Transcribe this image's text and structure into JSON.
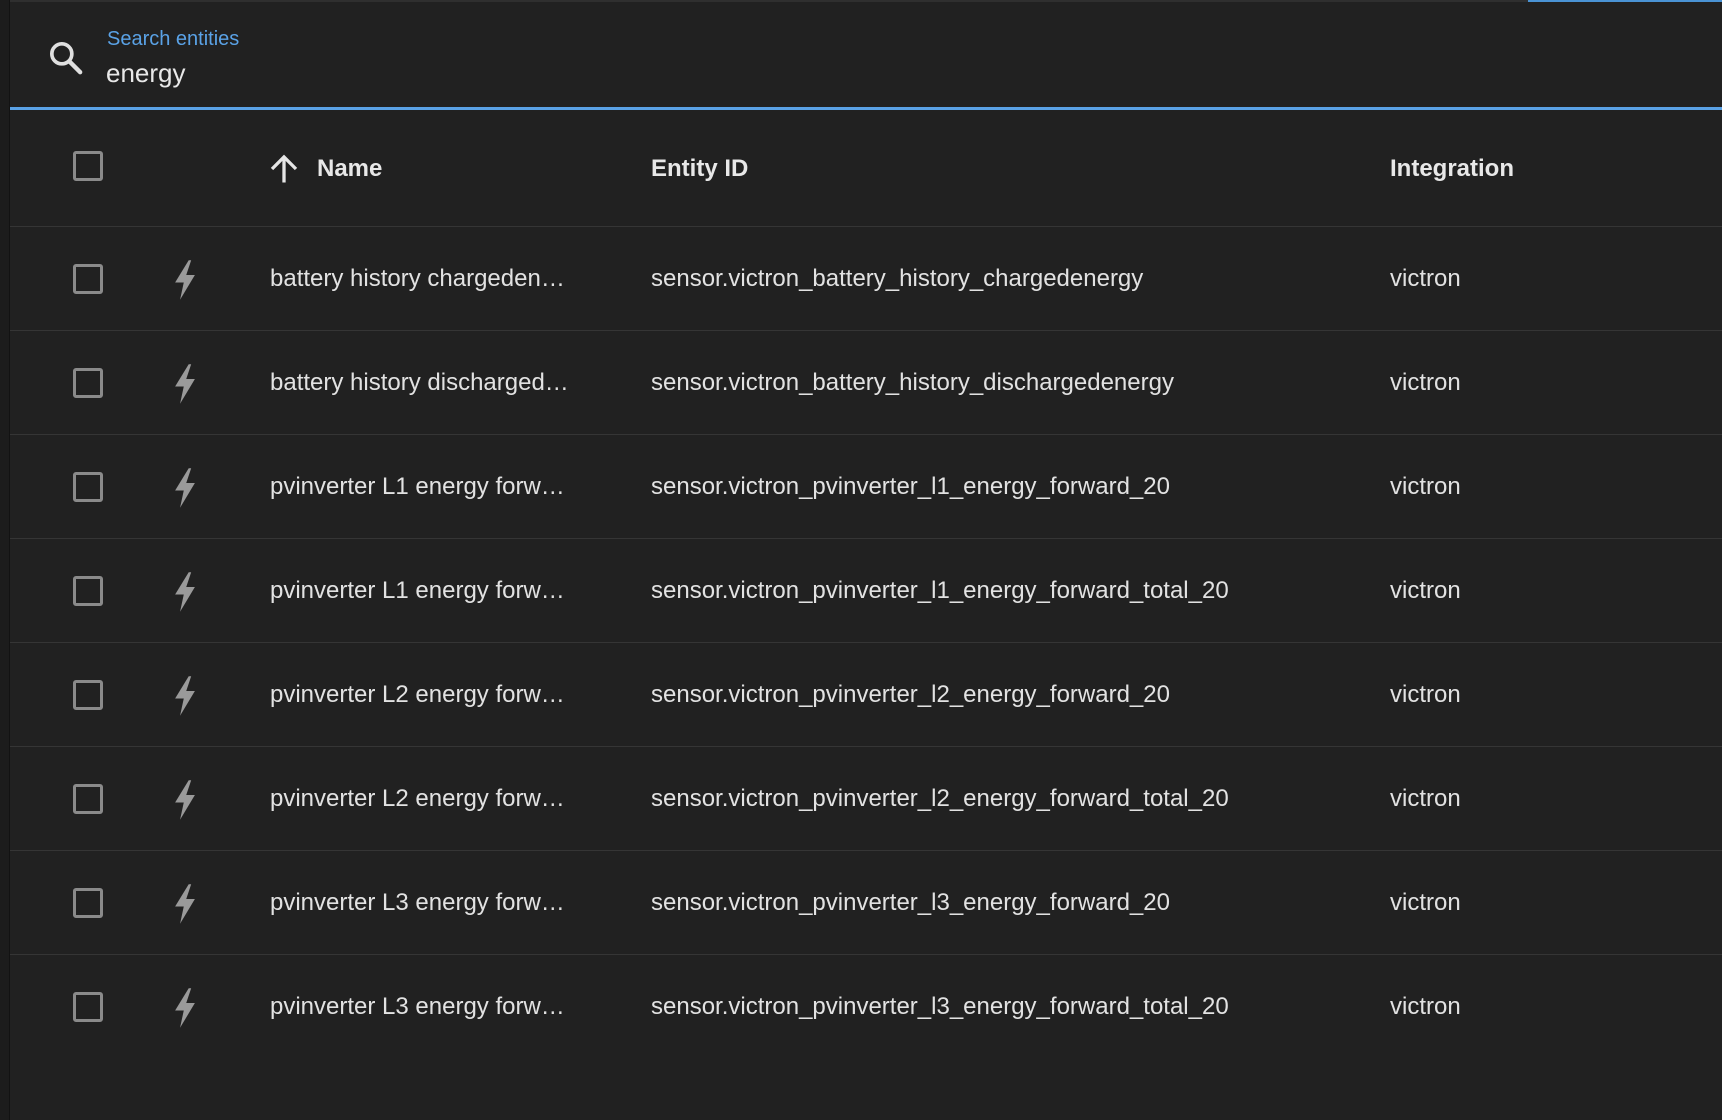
{
  "search": {
    "label": "Search entities",
    "value": "energy"
  },
  "table": {
    "columns": {
      "name": "Name",
      "entity_id": "Entity ID",
      "integration": "Integration"
    },
    "sort": {
      "column": "Name",
      "direction": "ascending"
    },
    "rows": [
      {
        "name": "battery history chargeden…",
        "entity_id": "sensor.victron_battery_history_chargedenergy",
        "integration": "victron",
        "icon": "lightning-bolt-icon"
      },
      {
        "name": "battery history discharged…",
        "entity_id": "sensor.victron_battery_history_dischargedenergy",
        "integration": "victron",
        "icon": "lightning-bolt-icon"
      },
      {
        "name": "pvinverter L1 energy forw…",
        "entity_id": "sensor.victron_pvinverter_l1_energy_forward_20",
        "integration": "victron",
        "icon": "lightning-bolt-icon"
      },
      {
        "name": "pvinverter L1 energy forw…",
        "entity_id": "sensor.victron_pvinverter_l1_energy_forward_total_20",
        "integration": "victron",
        "icon": "lightning-bolt-icon"
      },
      {
        "name": "pvinverter L2 energy forw…",
        "entity_id": "sensor.victron_pvinverter_l2_energy_forward_20",
        "integration": "victron",
        "icon": "lightning-bolt-icon"
      },
      {
        "name": "pvinverter L2 energy forw…",
        "entity_id": "sensor.victron_pvinverter_l2_energy_forward_total_20",
        "integration": "victron",
        "icon": "lightning-bolt-icon"
      },
      {
        "name": "pvinverter L3 energy forw…",
        "entity_id": "sensor.victron_pvinverter_l3_energy_forward_20",
        "integration": "victron",
        "icon": "lightning-bolt-icon"
      },
      {
        "name": "pvinverter L3 energy forw…",
        "entity_id": "sensor.victron_pvinverter_l3_energy_forward_total_20",
        "integration": "victron",
        "icon": "lightning-bolt-icon"
      }
    ]
  },
  "colors": {
    "accent": "#5aa2e6",
    "background": "#212121",
    "text": "#e2e2e2"
  }
}
